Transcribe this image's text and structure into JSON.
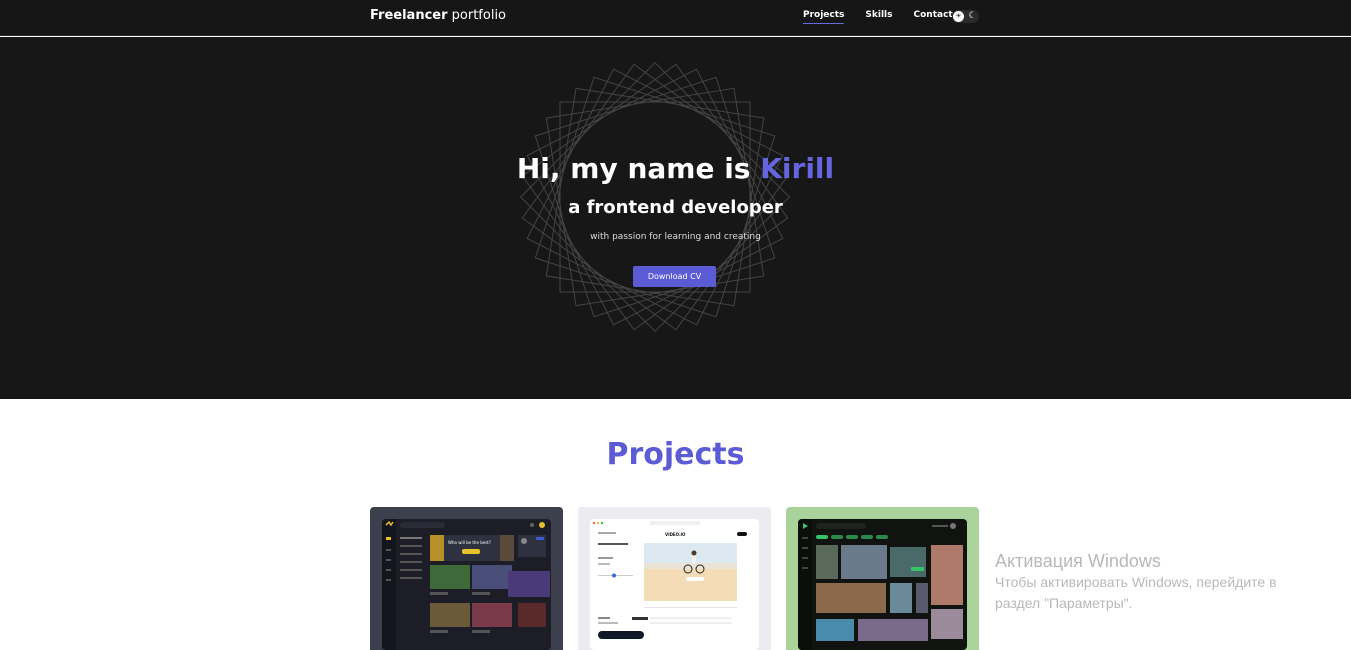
{
  "header": {
    "logo_bold": "Freelancer",
    "logo_rest": " portfolio",
    "nav": [
      {
        "label": "Projects",
        "active": true
      },
      {
        "label": "Skills",
        "active": false
      },
      {
        "label": "Contacts",
        "active": false
      }
    ],
    "theme_icons": [
      "sun-icon",
      "moon-icon"
    ]
  },
  "hero": {
    "greeting": "Hi, my name is ",
    "name": "Kirill",
    "subtitle": "a frontend developer",
    "tagline": "with passion for learning and creating",
    "cta_label": "Download CV"
  },
  "projects": {
    "title": "Projects",
    "cards": [
      {
        "type": "gaming-dashboard",
        "banner": "Who will be the best?"
      },
      {
        "type": "video-editor",
        "app_name": "VIDEO.IO"
      },
      {
        "type": "photo-gallery"
      }
    ]
  },
  "watermark": {
    "title": "Активация Windows",
    "line1": "Чтобы активировать Windows, перейдите в",
    "line2": "раздел \"Параметры\"."
  },
  "colors": {
    "accent": "#5b5bd6",
    "hero_bg": "#171717",
    "header_bg": "#161616",
    "card1_bg": "#3c3f4c",
    "card2_bg": "#ececf0",
    "card3_bg": "#a9d39b"
  }
}
